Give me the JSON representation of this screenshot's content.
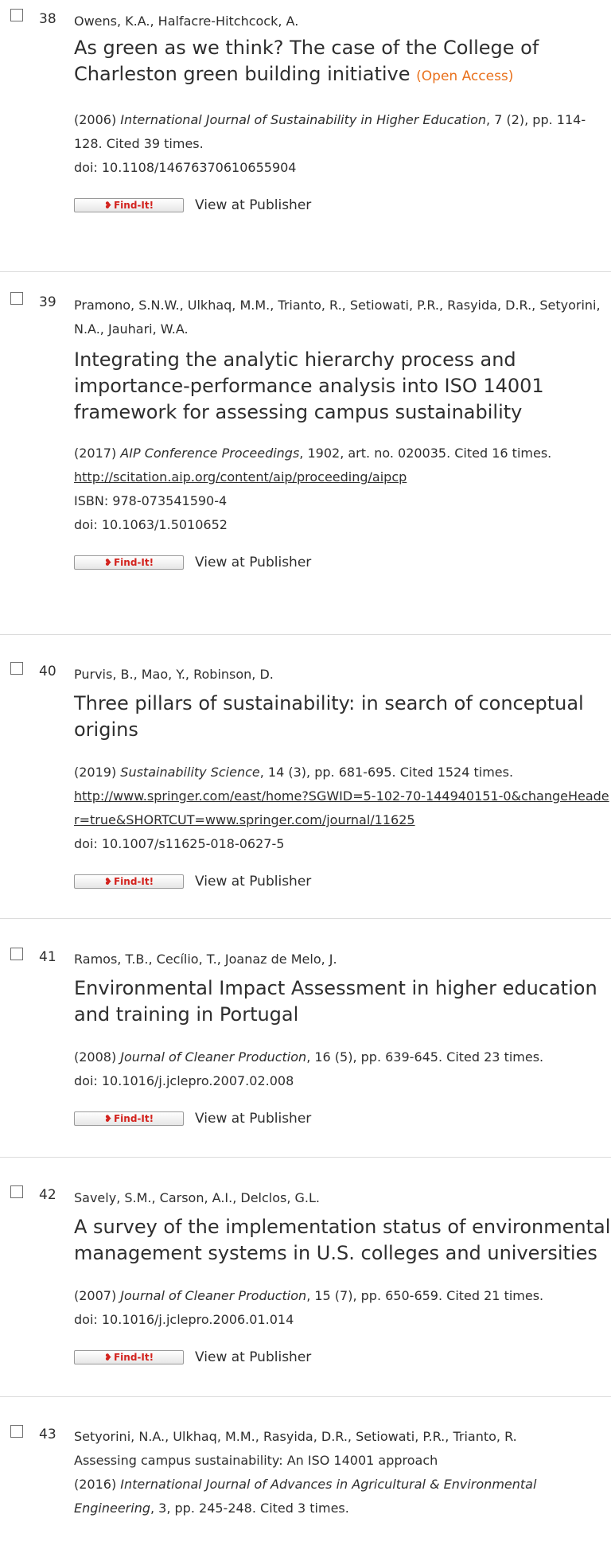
{
  "references": [
    {
      "number": "38",
      "authors": "Owens, K.A., Halfacre-Hitchcock, A.",
      "title": "As green as we think? The case of the College of Charleston green building initiative",
      "open_access": "(Open Access)",
      "year": "(2006)",
      "source": "International Journal of Sustainability in Higher Education",
      "details": ", 7 (2), pp. 114-128. Cited 39 times.",
      "doi": "doi: 10.1108/14676370610655904",
      "findit": "Find-It!",
      "view": "View at Publisher"
    },
    {
      "number": "39",
      "authors": "Pramono, S.N.W., Ulkhaq, M.M., Trianto, R., Setiowati, P.R., Rasyida, D.R., Setyorini, N.A., Jauhari, W.A.",
      "title": "Integrating the analytic hierarchy process and importance-performance analysis into ISO 14001 framework for assessing campus sustainability",
      "year": "(2017)",
      "source": "AIP Conference Proceedings",
      "details": ", 1902, art. no. 020035. Cited 16 times.",
      "url": "http://scitation.aip.org/content/aip/proceeding/aipcp",
      "isbn": "ISBN: 978-073541590-4",
      "doi": "doi: 10.1063/1.5010652",
      "findit": "Find-It!",
      "view": "View at Publisher"
    },
    {
      "number": "40",
      "authors": "Purvis, B., Mao, Y., Robinson, D.",
      "title": "Three pillars of sustainability: in search of conceptual origins",
      "year": "(2019)",
      "source": "Sustainability Science",
      "details": ", 14 (3), pp. 681-695. Cited 1524 times.",
      "url": "http://www.springer.com/east/home?SGWID=5-102-70-144940151-0&changeHeader=true&SHORTCUT=www.springer.com/journal/11625",
      "doi": "doi: 10.1007/s11625-018-0627-5",
      "findit": "Find-It!",
      "view": "View at Publisher"
    },
    {
      "number": "41",
      "authors": "Ramos, T.B., Cecílio, T., Joanaz de Melo, J.",
      "title": "Environmental Impact Assessment in higher education and training in Portugal",
      "year": "(2008)",
      "source": "Journal of Cleaner Production",
      "details": ", 16 (5), pp. 639-645. Cited 23 times.",
      "doi": "doi: 10.1016/j.jclepro.2007.02.008",
      "findit": "Find-It!",
      "view": "View at Publisher"
    },
    {
      "number": "42",
      "authors": "Savely, S.M., Carson, A.I., Delclos, G.L.",
      "title": "A survey of the implementation status of environmental management systems in U.S. colleges and universities",
      "year": "(2007)",
      "source": "Journal of Cleaner Production",
      "details": ", 15 (7), pp. 650-659. Cited 21 times.",
      "doi": "doi: 10.1016/j.jclepro.2006.01.014",
      "findit": "Find-It!",
      "view": "View at Publisher"
    },
    {
      "number": "43",
      "authors": "Setyorini, N.A., Ulkhaq, M.M., Rasyida, D.R., Setiowati, P.R., Trianto, R.",
      "title": "Assessing campus sustainability: An ISO 14001 approach",
      "year": "(2016)",
      "source": "International Journal of Advances in Agricultural & Environmental Engineering",
      "details": ", 3, pp. 245-248. Cited 3 times."
    }
  ]
}
